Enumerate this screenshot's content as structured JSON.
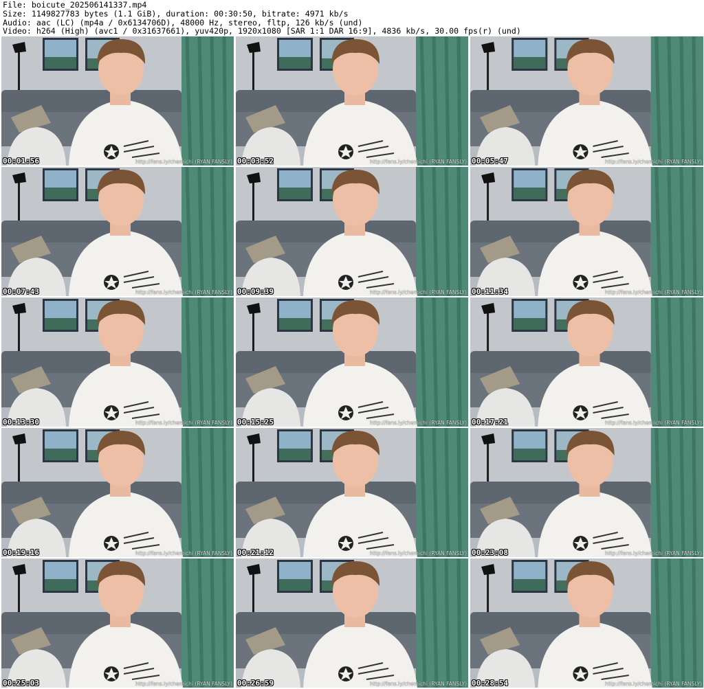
{
  "header": {
    "file_line": "File: boicute_202506141337.mp4",
    "size_line": "Size: 1149827783 bytes (1.1 GiB), duration: 00:30:50, bitrate: 4971 kb/s",
    "audio_line": "Audio: aac (LC) (mp4a / 0x6134706D), 48000 Hz, stereo, fltp, 126 kb/s (und)",
    "video_line": "Video: h264 (High) (avc1 / 0x31637661), yuv420p, 1920x1080 [SAR 1:1 DAR 16:9], 4836 kb/s, 30.00 fps(r) (und)"
  },
  "thumbnails": [
    {
      "timestamp": "00:01:56",
      "watermark": "http://fans.ly/chemichi (RYAN FANSLY)"
    },
    {
      "timestamp": "00:03:52",
      "watermark": "http://fans.ly/chemichi (RYAN FANSLY)"
    },
    {
      "timestamp": "00:05:47",
      "watermark": "http://fans.ly/chemichi (RYAN FANSLY)"
    },
    {
      "timestamp": "00:07:43",
      "watermark": "http://fans.ly/chemichi (RYAN FANSLY)"
    },
    {
      "timestamp": "00:09:39",
      "watermark": "http://fans.ly/chemichi (RYAN FANSLY)"
    },
    {
      "timestamp": "00:11:34",
      "watermark": "http://fans.ly/chemichi (RYAN FANSLY)"
    },
    {
      "timestamp": "00:13:30",
      "watermark": "http://fans.ly/chemichi (RYAN FANSLY)"
    },
    {
      "timestamp": "00:15:25",
      "watermark": "http://fans.ly/chemichi (RYAN FANSLY)"
    },
    {
      "timestamp": "00:17:21",
      "watermark": "http://fans.ly/chemichi (RYAN FANSLY)"
    },
    {
      "timestamp": "00:19:16",
      "watermark": "http://fans.ly/chemichi (RYAN FANSLY)"
    },
    {
      "timestamp": "00:21:12",
      "watermark": "http://fans.ly/chemichi (RYAN FANSLY)"
    },
    {
      "timestamp": "00:23:08",
      "watermark": "http://fans.ly/chemichi (RYAN FANSLY)"
    },
    {
      "timestamp": "00:25:03",
      "watermark": "http://fans.ly/chemichi (RYAN FANSLY)"
    },
    {
      "timestamp": "00:26:59",
      "watermark": "http://fans.ly/chemichi (RYAN FANSLY)"
    },
    {
      "timestamp": "00:28:54",
      "watermark": "http://fans.ly/chemichi (RYAN FANSLY)"
    }
  ]
}
